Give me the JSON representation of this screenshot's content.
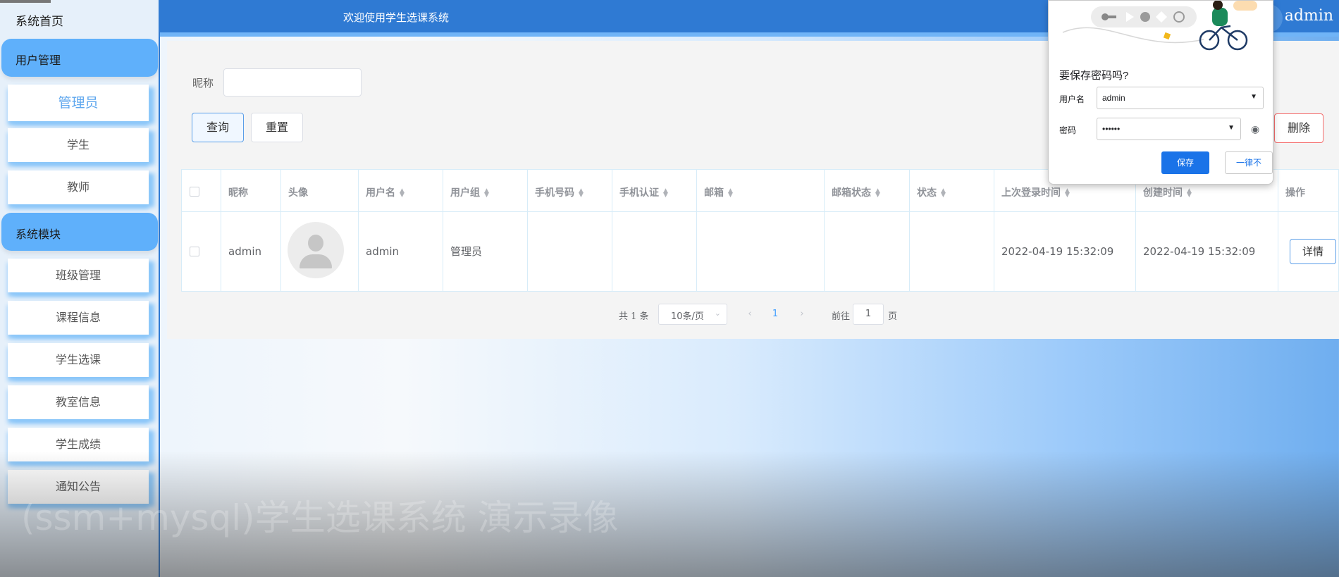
{
  "header": {
    "welcome": "欢迎使用学生选课系统",
    "user": "admin"
  },
  "sidebar": {
    "home": "系统首页",
    "groups": [
      {
        "label": "用户管理",
        "items": [
          "管理员",
          "学生",
          "教师"
        ]
      },
      {
        "label": "系统模块",
        "items": [
          "班级管理",
          "课程信息",
          "学生选课",
          "教室信息",
          "学生成绩",
          "通知公告"
        ]
      }
    ]
  },
  "search": {
    "label": "昵称",
    "value": ""
  },
  "buttons": {
    "query": "查询",
    "reset": "重置",
    "delete": "删除"
  },
  "table": {
    "columns": [
      "昵称",
      "头像",
      "用户名",
      "用户组",
      "手机号码",
      "手机认证",
      "邮箱",
      "邮箱状态",
      "状态",
      "上次登录时间",
      "创建时间",
      "操作"
    ],
    "rows": [
      {
        "nickname": "admin",
        "username": "admin",
        "group": "管理员",
        "phone": "",
        "phone_verified": "",
        "email": "",
        "email_status": "",
        "status": "",
        "last_login": "2022-04-19 15:32:09",
        "created": "2022-04-19 15:32:09",
        "action": "详情"
      }
    ]
  },
  "pagination": {
    "total": "共 1 条",
    "page_size": "10条/页",
    "current": "1",
    "goto_label": "前往",
    "goto_value": "1",
    "unit": "页"
  },
  "password_popup": {
    "title": "要保存密码吗?",
    "username_label": "用户名",
    "username_value": "admin",
    "password_label": "密码",
    "password_value": "••••••",
    "save": "保存",
    "never": "一律不"
  },
  "watermark": "(ssm+mysql)学生选课系统 演示录像",
  "colors": {
    "header": "#2f7ad3",
    "sidebar_group": "#5fb0fb",
    "primary": "#409eff",
    "chrome_blue": "#1a73e8",
    "danger": "#f56c6c"
  }
}
